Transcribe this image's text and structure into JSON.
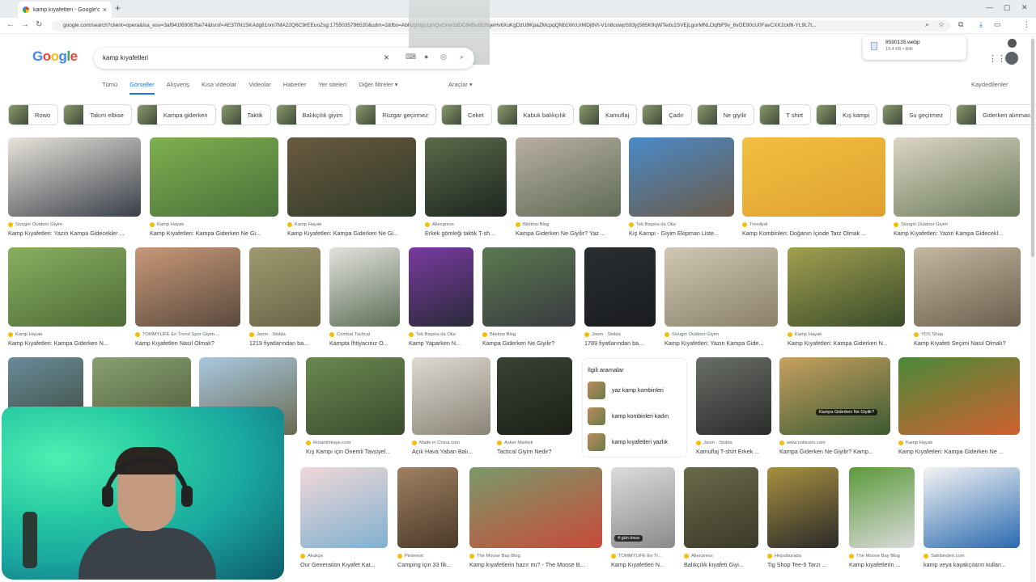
{
  "browser": {
    "tab_title": "kamp kıyafetleri - Google'da A...",
    "tab_close": "×",
    "new_tab": "+",
    "url": "google.com/search?client=opera&lsa_esv=3af941f69087be74&lsrsf=AE3TfN1SKAdg81nm7MA22Q6C9rEEunZsg:1755035796520&udm=2&fbs=AbNzjzhgs1jmQvOnw1dDD9kBuIB2fsjeHv6XuKgDzU9KpaZMcpqQNb1WcUrMDj8Vt-V1n8cowpS93yjS65K9qWTedu1SVEjLgorMNLOqfbF9v_6vOE90cU0FavCXK2ckf6-YL9L7t...",
    "download": {
      "name": "8590135.webp",
      "size": "19,4 KB • Bitti"
    }
  },
  "google": {
    "logo_letters": [
      "G",
      "o",
      "o",
      "g",
      "l",
      "e"
    ],
    "query": "kamp kıyafetleri",
    "clear": "×",
    "tabs": [
      "Tümü",
      "Görseller",
      "Alışveriş",
      "Kısa videolar",
      "Videolar",
      "Haberler",
      "Yer siteleri",
      "Diğer filtreler ▾"
    ],
    "active_tab": "Görseller",
    "tools": "Araçlar ▾",
    "saved": "Kaydedilenler",
    "chips": [
      "Rowo",
      "Takım elbise",
      "Kampa giderken",
      "Taktik",
      "Balıkçılık giyim",
      "Rüzgar geçirmez",
      "Ceket",
      "Kabuk balıkçılık",
      "Kamuflaj",
      "Çadır",
      "Ne giyilir",
      "T shirt",
      "Kış kampı",
      "Su geçirmez",
      "Giderken alınması"
    ],
    "related": {
      "title": "İlgili aramalar",
      "items": [
        "yaz kamp kombinleri",
        "kamp kombinleri kadın",
        "kamp kıyafetleri yazlık"
      ]
    }
  },
  "results": {
    "row1": [
      {
        "src": "Sivugin Outdoor Giyim",
        "cap": "Kamp Kıyafetleri: Yazın Kampa Gidecekler ...",
        "c1": "#e8e4dc",
        "c2": "#3a3f48"
      },
      {
        "src": "Kamp Hayatı",
        "cap": "Kamp Kıyafetleri: Kampa Giderken Ne Gi...",
        "c1": "#7fb050",
        "c2": "#4a6f3a"
      },
      {
        "src": "Kamp Hayatı",
        "cap": "Kamp Kıyafetleri: Kampa Giderken Ne Gi...",
        "c1": "#6a5a40",
        "c2": "#2e3a28"
      },
      {
        "src": "Aliexpress",
        "cap": "Erkek gömleği taktik T-sh...",
        "c1": "#5b6b4a",
        "c2": "#1e2520"
      },
      {
        "src": "Biletino Blog",
        "cap": "Kampa Giderken Ne Giyilir? Yaz ...",
        "c1": "#b8b0a0",
        "c2": "#5e6a55"
      },
      {
        "src": "Tek Başına da Olur",
        "cap": "Kış Kampı - Giyim Ekipman Liste...",
        "c1": "#4a8ac8",
        "c2": "#6b5a48"
      },
      {
        "src": "Trendyol",
        "cap": "Kamp Kombinleri: Doğanın İçinde Tarz Olmak ...",
        "c1": "#f0c040",
        "c2": "#e0a030"
      },
      {
        "src": "Sivugin Outdoor Giyim",
        "cap": "Kamp Kıyafetleri: Yazın Kampa Gidecekl...",
        "c1": "#dcd6c4",
        "c2": "#6a7a5a"
      }
    ],
    "row2": [
      {
        "src": "Kamp Hayatı",
        "cap": "Kamp Kıyafetleri: Kampa Giderken N...",
        "c1": "#88b060",
        "c2": "#4e6a38"
      },
      {
        "src": "TOMMYLIFE En Trend Spor Giyim ...",
        "cap": "Kamp Kıyafetleri Nasıl Olmalı?",
        "c1": "#c89878",
        "c2": "#5a4a3e"
      },
      {
        "src": "Joom · Stokta",
        "cap": "1219 fiyatlarından ba...",
        "c1": "#a09a70",
        "c2": "#6a6448"
      },
      {
        "src": "Combat Tactical",
        "cap": "Kampta İhtiyacınız O...",
        "c1": "#e4e2de",
        "c2": "#5e7058"
      },
      {
        "src": "Tek Başına da Olur",
        "cap": "Kamp Yaparken N...",
        "c1": "#7a3aa0",
        "c2": "#2a2a3a"
      },
      {
        "src": "Biletino Blog",
        "cap": "Kampa Giderken Ne Giyilir?",
        "c1": "#5a7a50",
        "c2": "#3a3a40"
      },
      {
        "src": "Joom · Stokta",
        "cap": "1789 fiyatlarından ba...",
        "c1": "#2a2e32",
        "c2": "#1a1c1e"
      },
      {
        "src": "Sivugin Outdoor Giyim",
        "cap": "Kamp Kıyafetleri: Yazın Kampa Gide...",
        "c1": "#d0c8b4",
        "c2": "#8a8068"
      },
      {
        "src": "Kamp Hayatı",
        "cap": "Kamp Kıyafetleri: Kampa Giderken N...",
        "c1": "#a0a050",
        "c2": "#3a4a2a"
      },
      {
        "src": "YDS Shop",
        "cap": "Kamp Kıyafeti Seçimi Nasıl Olmalı?",
        "c1": "#c4b8a0",
        "c2": "#6a5e4e"
      }
    ],
    "row3": [
      {
        "src": "",
        "cap": "",
        "c1": "#6a8a9a",
        "c2": "#3a4a3a"
      },
      {
        "src": "",
        "cap": "",
        "c1": "#8aa070",
        "c2": "#4a5a3a"
      },
      {
        "src": "",
        "cap": "",
        "c1": "#a8c8e0",
        "c2": "#6a6a50"
      },
      {
        "src": "Rotamhikaye.com",
        "cap": "Kış Kampı için Önemli Tavsiyel...",
        "c1": "#6a8a50",
        "c2": "#3a4a2e"
      },
      {
        "src": "Made in China.com",
        "cap": "Açık Hava Yaban Balı...",
        "c1": "#dedad0",
        "c2": "#8a8478"
      },
      {
        "src": "Asker Marketi",
        "cap": "Tactical Giyim Nedir?",
        "c1": "#3a4232",
        "c2": "#1c2018"
      },
      {
        "src": "Joom · Stokta",
        "cap": "Kamuflaj T-shirt Erkek ...",
        "c1": "#6a6e68",
        "c2": "#2a2c2a"
      },
      {
        "src": "www.cokicem.com",
        "cap": "Kampa Giderken Ne Giyilir? Kamp...",
        "c1": "#c8a060",
        "c2": "#3a5a32"
      },
      {
        "src": "Kamp Hayatı",
        "cap": "Kamp Kıyafetleri: Kampa Giderken Ne ...",
        "c1": "#4a8a3a",
        "c2": "#d06030"
      }
    ],
    "row3_badge": "Kampa Giderken Ne Giyilir?",
    "row4": [
      {
        "src": "Akakçe",
        "cap": "Our Generation Kıyafet Kat...",
        "c1": "#f0d8d8",
        "c2": "#80b0d0"
      },
      {
        "src": "Pinterest",
        "cap": "Camping için 33 fik...",
        "c1": "#a08060",
        "c2": "#4a3a2a"
      },
      {
        "src": "The Moose Bay Blog",
        "cap": "Kamp kıyafetlerin hazır mı? - The Moose B...",
        "c1": "#7a9a6a",
        "c2": "#c84a3a"
      },
      {
        "src": "TOMMYLIFE En Tr...",
        "cap": "Kamp Kıyafetleri N...",
        "c1": "#dcdcdc",
        "c2": "#8a8a8a"
      },
      {
        "src": "Aliexpress",
        "cap": "Balıkçılık kıyafeti Giyi...",
        "c1": "#6a6a4a",
        "c2": "#3a3a2a"
      },
      {
        "src": "Hepsiburada",
        "cap": "Tig Shop Tee-5 Tarzı ...",
        "c1": "#a89040",
        "c2": "#2a2a2a"
      },
      {
        "src": "The Moose Bay Blog",
        "cap": "Kamp kıyafetlerin ...",
        "c1": "#5a9a3a",
        "c2": "#dadada"
      },
      {
        "src": "Sahibinden.com",
        "cap": "kamp veya kayakçıların kullan...",
        "c1": "#f4f4f4",
        "c2": "#2a6ab0"
      }
    ],
    "row4_badge": "4 gün önce"
  }
}
